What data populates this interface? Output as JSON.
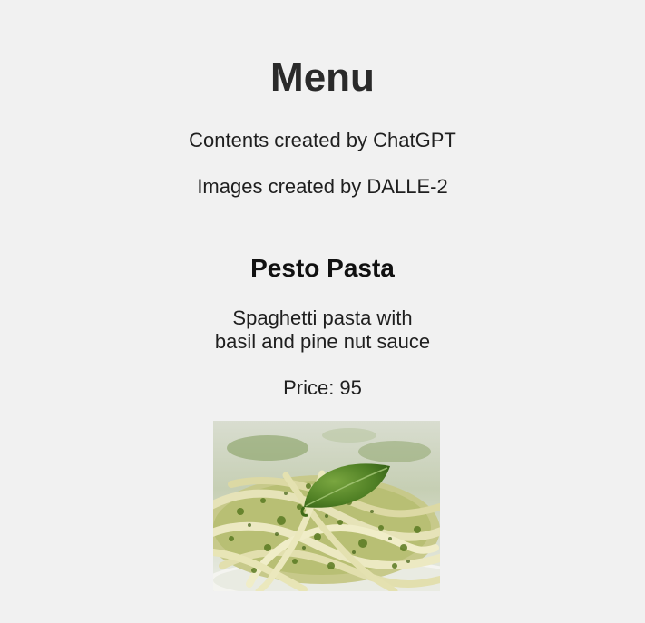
{
  "header": {
    "title": "Menu",
    "credit_contents": "Contents created by ChatGPT",
    "credit_images": "Images created by DALLE-2"
  },
  "items": [
    {
      "name": "Pesto Pasta",
      "description_line1": "Spaghetti pasta with",
      "description_line2": "basil and pine nut sauce",
      "price_label": "Price: 95",
      "image_icon": "pesto-pasta-photo"
    }
  ]
}
